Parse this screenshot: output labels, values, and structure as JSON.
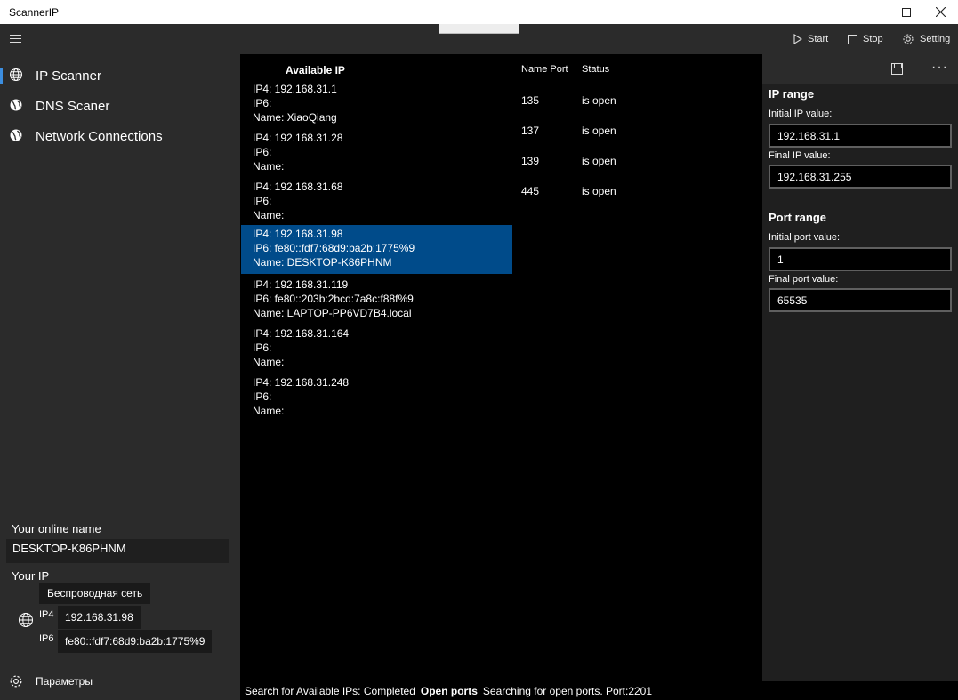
{
  "window": {
    "title": "ScannerIP"
  },
  "commands": {
    "start": "Start",
    "stop": "Stop",
    "setting": "Setting"
  },
  "nav": [
    {
      "label": "IP Scanner",
      "icon": "globe-icon",
      "selected": true
    },
    {
      "label": "DNS Scaner",
      "icon": "globe-filled-icon",
      "selected": false
    },
    {
      "label": "Network Connections",
      "icon": "globe-filled-icon",
      "selected": false
    }
  ],
  "sidebar": {
    "online_name_label": "Your online name",
    "online_name": "DESKTOP-K86PHNM",
    "your_ip_label": "Your IP",
    "adapter": "Беспроводная сеть",
    "ip4_tag": "IP4",
    "ip4": "192.168.31.98",
    "ip6_tag": "IP6",
    "ip6": "fe80::fdf7:68d9:ba2b:1775%9",
    "settings_label": "Параметры"
  },
  "ip_list": {
    "header": "Available IP",
    "selected_index": 3,
    "entries": [
      {
        "ip4": "IP4: 192.168.31.1",
        "ip6": "IP6:",
        "name": "Name: XiaoQiang"
      },
      {
        "ip4": "IP4: 192.168.31.28",
        "ip6": "IP6:",
        "name": "Name:"
      },
      {
        "ip4": "IP4: 192.168.31.68",
        "ip6": "IP6:",
        "name": "Name:"
      },
      {
        "ip4": "IP4: 192.168.31.98",
        "ip6": "IP6: fe80::fdf7:68d9:ba2b:1775%9",
        "name": "Name: DESKTOP-K86PHNM"
      },
      {
        "ip4": "IP4: 192.168.31.119",
        "ip6": "IP6: fe80::203b:2bcd:7a8c:f88f%9",
        "name": "Name: LAPTOP-PP6VD7B4.local"
      },
      {
        "ip4": "IP4: 192.168.31.164",
        "ip6": "IP6:",
        "name": "Name:"
      },
      {
        "ip4": "IP4: 192.168.31.248",
        "ip6": "IP6:",
        "name": "Name:"
      }
    ]
  },
  "ports": {
    "header_port": "Name Port",
    "header_status": "Status",
    "rows": [
      {
        "port": "135",
        "status": "is open"
      },
      {
        "port": "137",
        "status": "is open"
      },
      {
        "port": "139",
        "status": "is open"
      },
      {
        "port": "445",
        "status": "is open"
      }
    ]
  },
  "settings_panel": {
    "ip_range_title": "IP range",
    "initial_ip_label": "Initial IP value:",
    "initial_ip": "192.168.31.1",
    "final_ip_label": "Final IP value:",
    "final_ip": "192.168.31.255",
    "port_range_title": "Port range",
    "initial_port_label": "Initial port value:",
    "initial_port": "1",
    "final_port_label": "Final port value:",
    "final_port": "65535",
    "more_glyph": "···"
  },
  "status": {
    "ips": "Search for Available IPs: Completed",
    "ports_label": "Open ports",
    "ports_progress": "Searching for open ports. Port:2201"
  },
  "colors": {
    "accent": "#004b8a",
    "sidebar_bg": "#2b2b2b",
    "panel_bg": "#1f1f1f"
  }
}
